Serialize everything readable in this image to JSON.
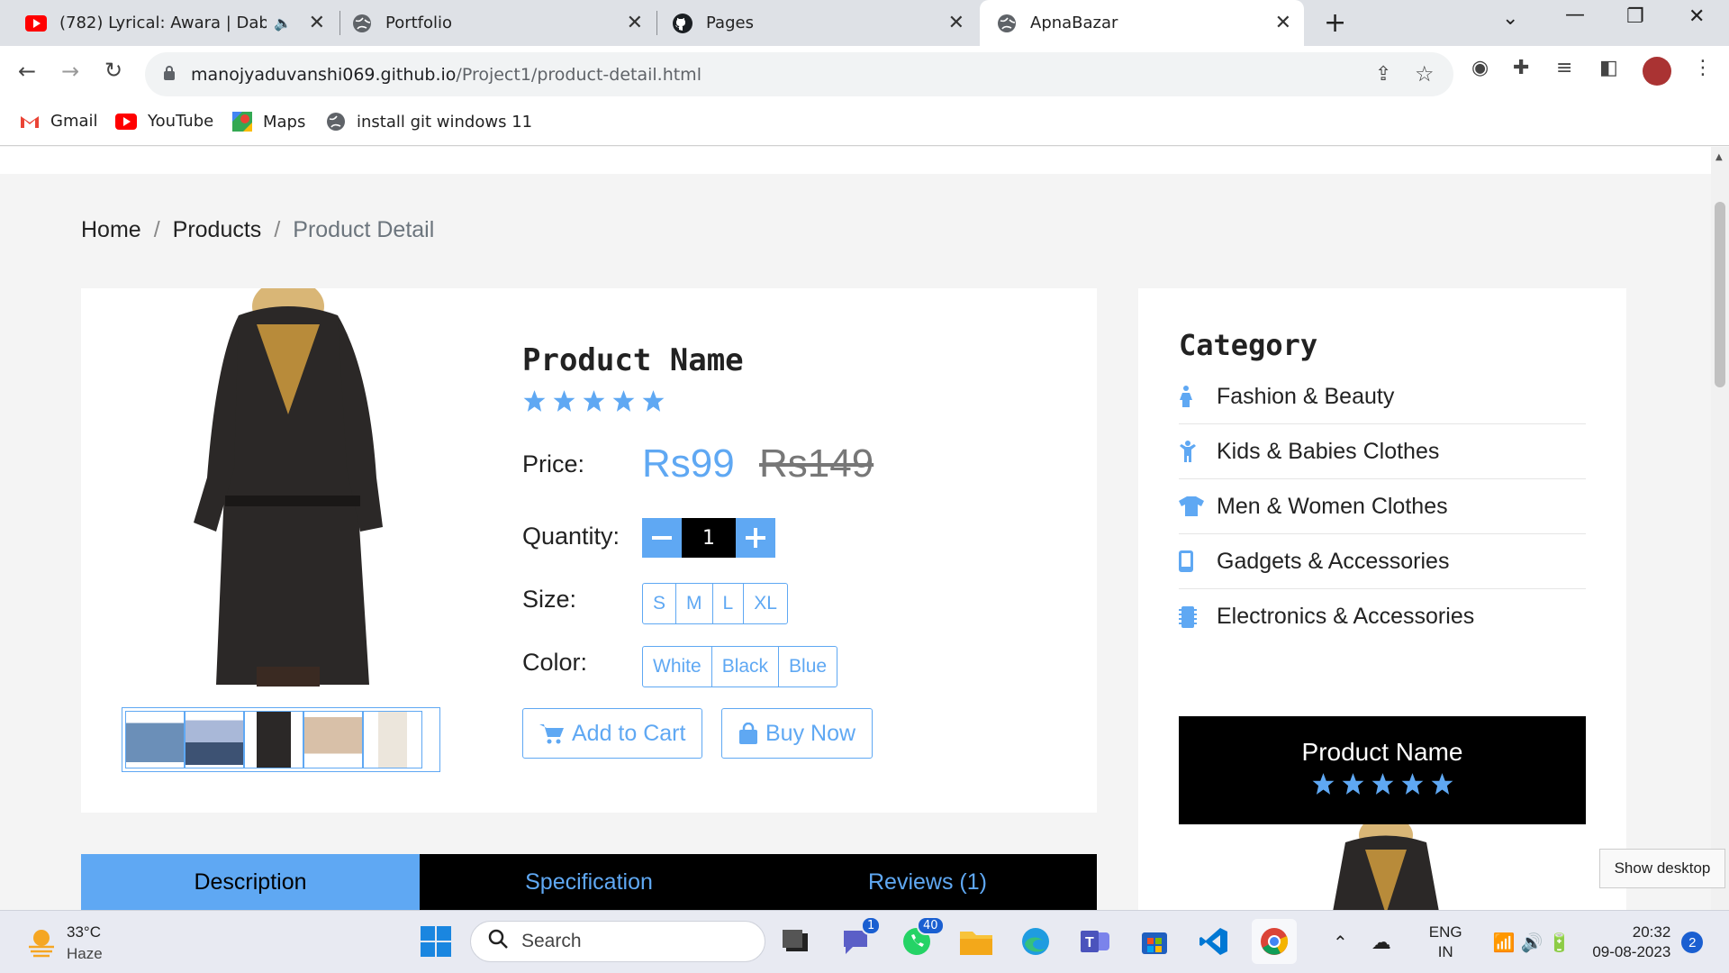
{
  "browser": {
    "tabs": [
      {
        "title": "(782) Lyrical: Awara | Dabang",
        "icon": "youtube-icon"
      },
      {
        "title": "Portfolio",
        "icon": "globe-icon"
      },
      {
        "title": "Pages",
        "icon": "github-icon"
      },
      {
        "title": "ApnaBazar",
        "icon": "globe-icon",
        "active": true
      }
    ],
    "new_tab": "+",
    "url_host": "manojyaduvanshi069.github.io",
    "url_path": "/Project1/product-detail.html",
    "bookmarks": [
      {
        "label": "Gmail",
        "icon": "gmail-icon"
      },
      {
        "label": "YouTube",
        "icon": "youtube-icon"
      },
      {
        "label": "Maps",
        "icon": "maps-icon"
      },
      {
        "label": "install git windows 11",
        "icon": "globe-icon"
      }
    ]
  },
  "breadcrumb": {
    "home": "Home",
    "products": "Products",
    "current": "Product Detail"
  },
  "product": {
    "name": "Product Name",
    "rating": 5,
    "price_label": "Price:",
    "price": "Rs99",
    "old_price": "Rs149",
    "quantity_label": "Quantity:",
    "quantity": "1",
    "size_label": "Size:",
    "sizes": [
      "S",
      "M",
      "L",
      "XL"
    ],
    "color_label": "Color:",
    "colors": [
      "White",
      "Black",
      "Blue"
    ],
    "add_to_cart": "Add to Cart",
    "buy_now": "Buy Now"
  },
  "tabs": [
    "Description",
    "Specification",
    "Reviews (1)"
  ],
  "sidebar": {
    "category_title": "Category",
    "categories": [
      {
        "label": "Fashion & Beauty",
        "icon": "female-icon"
      },
      {
        "label": "Kids & Babies Clothes",
        "icon": "child-icon"
      },
      {
        "label": "Men & Women Clothes",
        "icon": "tshirt-icon"
      },
      {
        "label": "Gadgets & Accessories",
        "icon": "mobile-icon"
      },
      {
        "label": "Electronics & Accessories",
        "icon": "microchip-icon"
      }
    ],
    "promo_name": "Product Name",
    "promo_rating": 5
  },
  "tooltip": "Show desktop",
  "taskbar": {
    "temperature": "33°C",
    "condition": "Haze",
    "search": "Search",
    "teams_badge": "1",
    "whatsapp_badge": "40",
    "lang1": "ENG",
    "lang2": "IN",
    "time": "20:32",
    "date": "09-08-2023",
    "notification_count": "2"
  },
  "colors": {
    "accent": "#5fa8f3",
    "dark": "#000000"
  }
}
